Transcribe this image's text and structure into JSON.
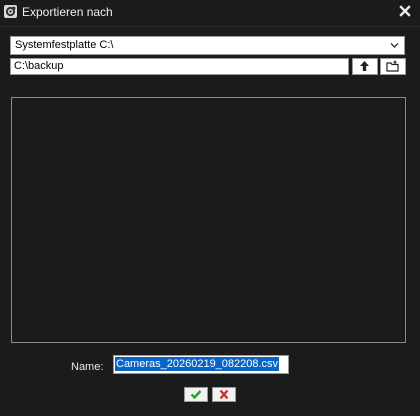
{
  "window": {
    "title": "Exportieren nach"
  },
  "icons": {
    "app": "settings-gear-icon",
    "close": "close-icon",
    "dropdown": "chevron-down-icon",
    "up": "arrow-up-icon",
    "new_folder": "new-folder-icon",
    "ok": "checkmark-icon",
    "cancel": "cross-icon"
  },
  "drive": {
    "selected": "Systemfestplatte C:\\"
  },
  "path": {
    "value": "C:\\backup"
  },
  "filename": {
    "label": "Name:",
    "value": "Cameras_20260219_082208.csv"
  },
  "colors": {
    "background": "#1b1b1b",
    "ok_green": "#2e9a2e",
    "cancel_red": "#d03030",
    "selection": "#0a64c8"
  }
}
